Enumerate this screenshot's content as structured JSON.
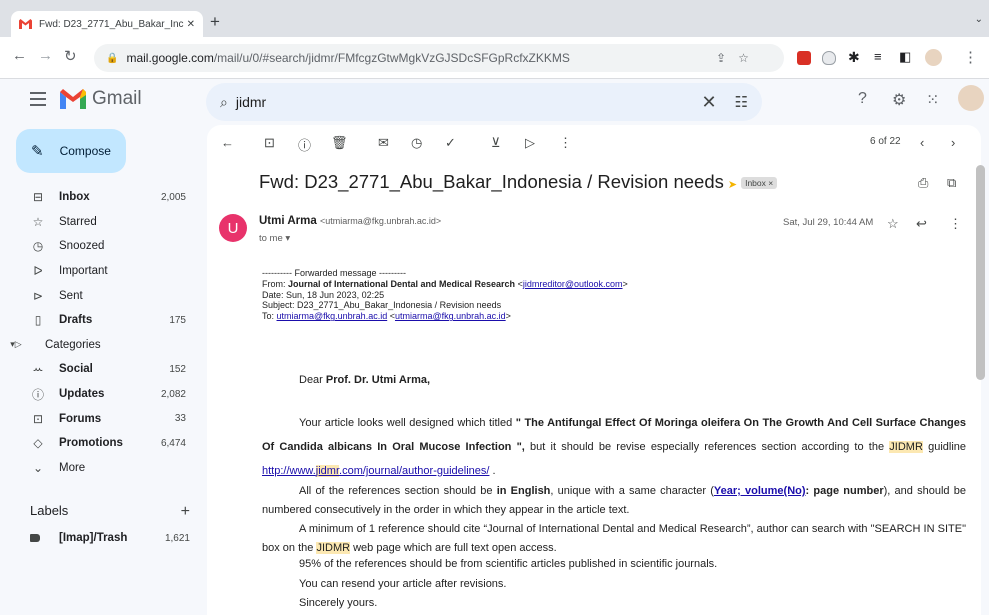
{
  "browser": {
    "tab_title": "Fwd: D23_2771_Abu_Bakar_Inc",
    "url_host": "mail.google.com",
    "url_path": "/mail/u/0/#search/jidmr/FMfcgzGtwMgkVzGJSDcSFGpRcfxZKKMS"
  },
  "gmail": {
    "wordmark": "Gmail",
    "search_value": "jidmr",
    "compose_label": "Compose"
  },
  "sidebar": {
    "items": [
      {
        "label": "Inbox",
        "count": "2,005",
        "icon": "inbox-icon"
      },
      {
        "label": "Starred",
        "count": "",
        "icon": "star-icon"
      },
      {
        "label": "Snoozed",
        "count": "",
        "icon": "clock-icon"
      },
      {
        "label": "Important",
        "count": "",
        "icon": "important-icon"
      },
      {
        "label": "Sent",
        "count": "",
        "icon": "send-icon"
      },
      {
        "label": "Drafts",
        "count": "175",
        "icon": "draft-icon"
      },
      {
        "label": "Categories",
        "count": "",
        "icon": "label-icon"
      },
      {
        "label": "Social",
        "count": "152",
        "icon": "people-icon"
      },
      {
        "label": "Updates",
        "count": "2,082",
        "icon": "info-icon"
      },
      {
        "label": "Forums",
        "count": "33",
        "icon": "forum-icon"
      },
      {
        "label": "Promotions",
        "count": "6,474",
        "icon": "tag-icon"
      },
      {
        "label": "More",
        "count": "",
        "icon": "chevron-down-icon"
      }
    ],
    "labels_heading": "Labels",
    "label_item": {
      "label": "[Imap]/Trash",
      "count": "1,621"
    }
  },
  "message": {
    "pager": "6 of 22",
    "subject": "Fwd: D23_2771_Abu_Bakar_Indonesia / Revision needs",
    "chip": "Inbox ×",
    "sender_initial": "U",
    "sender_name": "Utmi Arma",
    "sender_email": "<utmiarma@fkg.unbrah.ac.id>",
    "to_me": "to me ▾",
    "date": "Sat, Jul 29, 10:44 AM",
    "forward": {
      "header": "---------- Forwarded message ---------",
      "from_label": "From: ",
      "from_name": "Journal of International Dental and Medical Research",
      "from_email": "jidmreditor@outlook.com",
      "date_line": "Date: Sun, 18 Jun 2023, 02:25",
      "subject_line": "Subject: D23_2771_Abu_Bakar_Indonesia / Revision needs",
      "to_label": "To: ",
      "to_email": "utmiarma@fkg.unbrah.ac.id"
    },
    "body": {
      "greeting_prefix": "Dear ",
      "greeting_name": "Prof. Dr. Utmi Arma,",
      "p1_a": "Your article looks well designed which titled ",
      "p1_title": "\" The Antifungal Effect Of Moringa oleifera On The Growth And Cell Surface Changes Of Candida albicans In Oral Mucose Infection \",",
      "p1_b": " but it should be revise especially references section according to the ",
      "p1_jidmr": "JIDMR",
      "p1_c": " guidline ",
      "p1_link_a": "http://www.",
      "p1_link_hl": "jidmr",
      "p1_link_b": ".com/journal/author-guidelines/",
      "p1_d": " .",
      "p2_a": "All of the references section should be ",
      "p2_bold": "in English",
      "p2_b": ", unique with a same character (",
      "p2_link": "Year; volume(No)",
      "p2_bold2": ": page number",
      "p2_c": "), and should be numbered consecutively in the order in which they appear in the article text.",
      "p3_a": "A minimum of 1 reference should cite “Journal of International Dental and Medical Research”, author can search with \"SEARCH IN SITE\" box on the ",
      "p3_jidmr": "JIDMR",
      "p3_b": " web page which are full text open access.",
      "p4": "95% of the references should be from scientific articles published in scientific journals.",
      "p5": "You can resend your article after revisions.",
      "p6": "Sincerely yours."
    }
  }
}
